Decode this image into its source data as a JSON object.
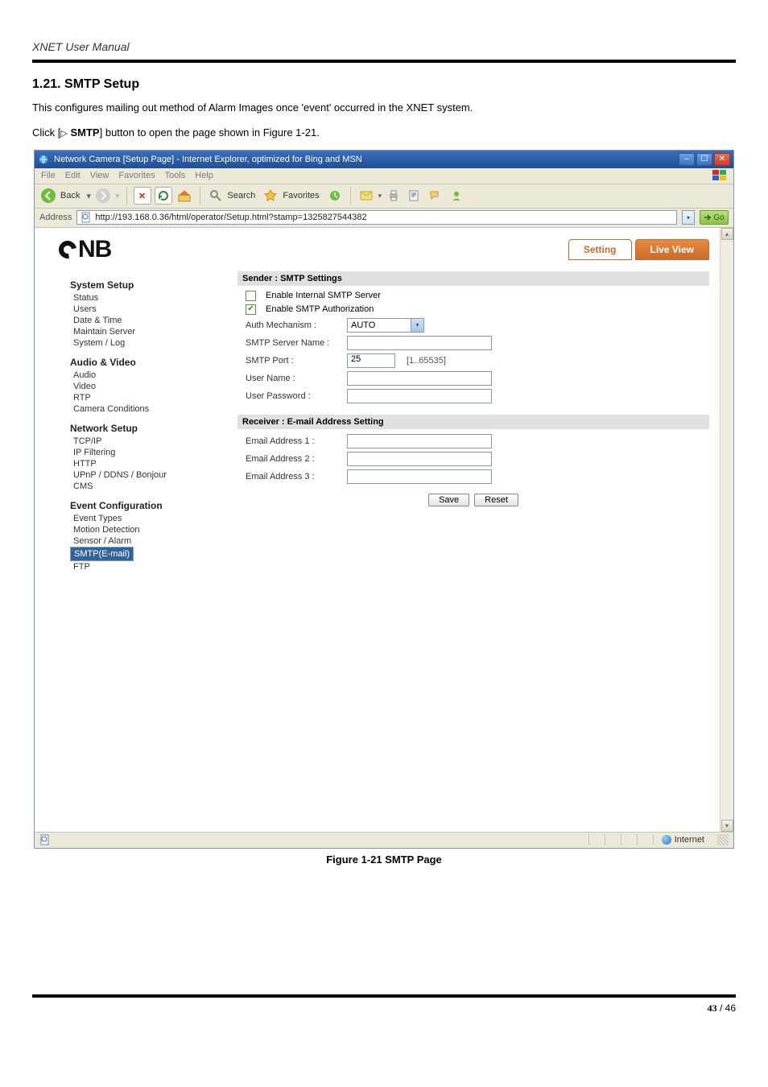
{
  "doc": {
    "header": "XNET User Manual",
    "section_number": "1.21.",
    "section_title": "SMTP Setup",
    "intro": "This configures mailing out method of Alarm Images once 'event' occurred in the XNET system.",
    "click_prefix": "Click [",
    "click_tri": "▷",
    "click_bold": "SMTP",
    "click_suffix": "] button to open the page shown in Figure 1-21.",
    "figure_caption": "Figure 1-21 SMTP Page",
    "page_current": "43",
    "page_sep": " / ",
    "page_total": "46"
  },
  "browser": {
    "title": "Network Camera [Setup Page] - Internet Explorer, optimized for Bing and MSN",
    "menus": [
      "File",
      "Edit",
      "View",
      "Favorites",
      "Tools",
      "Help"
    ],
    "back_label": "Back",
    "search_label": "Search",
    "favorites_label": "Favorites",
    "address_label": "Address",
    "url": "http://193.168.0.36/html/operator/Setup.html?stamp=1325827544382",
    "go_label": "Go",
    "status_zone": "Internet"
  },
  "tabs": {
    "setting": "Setting",
    "liveview": "Live View"
  },
  "sidebar": {
    "groups": [
      {
        "title": "System Setup",
        "items": [
          "Status",
          "Users",
          "Date & Time",
          "Maintain Server",
          "System / Log"
        ]
      },
      {
        "title": "Audio & Video",
        "items": [
          "Audio",
          "Video",
          "RTP",
          "Camera Conditions"
        ]
      },
      {
        "title": "Network Setup",
        "items": [
          "TCP/IP",
          "IP Filtering",
          "HTTP",
          "UPnP / DDNS / Bonjour",
          "CMS"
        ]
      },
      {
        "title": "Event Configuration",
        "items": [
          "Event Types",
          "Motion Detection",
          "Sensor / Alarm",
          "SMTP(E-mail)",
          "FTP"
        ],
        "selected": "SMTP(E-mail)"
      }
    ]
  },
  "form": {
    "sender_title": "Sender : SMTP Settings",
    "enable_internal": "Enable Internal SMTP Server",
    "enable_auth": "Enable SMTP Authorization",
    "auth_mech_label": "Auth Mechanism :",
    "auth_mech_value": "AUTO",
    "server_name_label": "SMTP Server Name :",
    "server_name_value": "",
    "port_label": "SMTP Port :",
    "port_value": "25",
    "port_hint": "[1..65535]",
    "user_label": "User Name :",
    "user_value": "",
    "pass_label": "User Password :",
    "pass_value": "",
    "receiver_title": "Receiver : E-mail Address Setting",
    "email1_label": "Email Address 1 :",
    "email2_label": "Email Address 2 :",
    "email3_label": "Email Address 3 :",
    "email1_value": "",
    "email2_value": "",
    "email3_value": "",
    "save": "Save",
    "reset": "Reset"
  }
}
